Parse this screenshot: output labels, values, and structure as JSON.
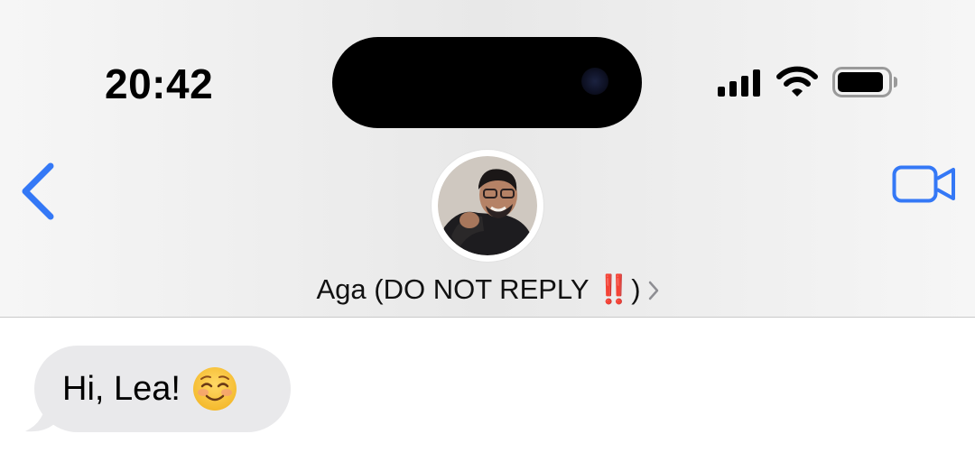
{
  "status_bar": {
    "time": "20:42",
    "signal_bars": 4,
    "battery_level": 0.9
  },
  "nav": {
    "back_icon": "chevron-left-icon",
    "video_icon": "video-camera-icon",
    "contact_name": "Aga (DO NOT REPLY ‼️)",
    "accent_color": "#3478f6"
  },
  "messages": [
    {
      "direction": "incoming",
      "text": "Hi, Lea!",
      "emoji": "smiling-face-icon"
    }
  ],
  "colors": {
    "incoming_bubble": "#e9e9eb",
    "header_bg": "#efefef"
  }
}
